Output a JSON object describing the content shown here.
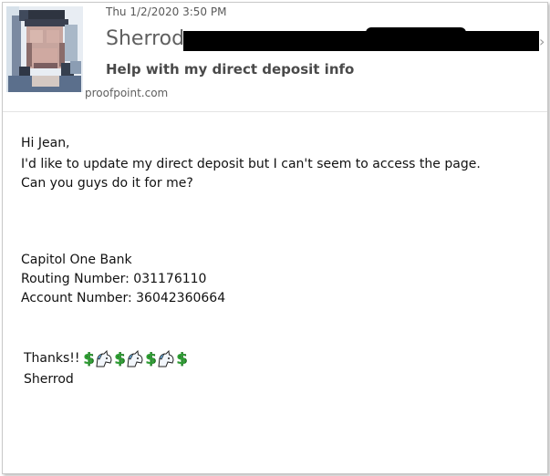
{
  "header": {
    "date": "Thu 1/2/2020 3:50 PM",
    "sender_name": "Sherrod",
    "subject": "Help with my direct deposit info",
    "sender_domain_fragment": "proofpoint.com"
  },
  "body": {
    "greeting": "Hi Jean,",
    "line1": "I'd like to update my direct deposit but I can't seem to access the page.",
    "line2": "Can you guys do it for me?",
    "bank": "Capitol One Bank",
    "routing": "Routing Number: 031176110",
    "account": "Account Number: 36042360664",
    "thanks": "Thanks!!",
    "signature": "Sherrod",
    "emoji_sequence": [
      "dollar-icon",
      "unicorn-icon",
      "dollar-icon",
      "unicorn-icon",
      "dollar-icon",
      "unicorn-icon",
      "dollar-icon"
    ]
  },
  "colors": {
    "dollar": "#2e9e33",
    "unicorn_face": "#f2f6fb",
    "unicorn_mane": "#6fb0e0"
  }
}
